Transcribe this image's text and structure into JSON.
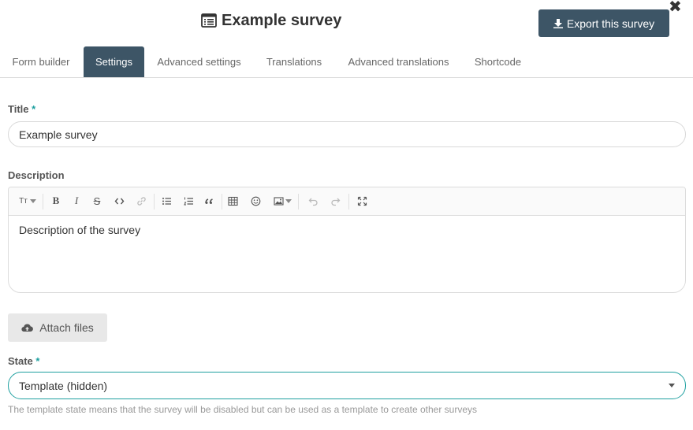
{
  "header": {
    "title": "Example survey",
    "title_icon": "list-alt-icon",
    "export_label": "Export this survey",
    "export_icon": "download-icon",
    "close_icon": "close-icon",
    "close_glyph": "✖"
  },
  "tabs": [
    {
      "label": "Form builder",
      "active": false
    },
    {
      "label": "Settings",
      "active": true
    },
    {
      "label": "Advanced settings",
      "active": false
    },
    {
      "label": "Translations",
      "active": false
    },
    {
      "label": "Advanced translations",
      "active": false
    },
    {
      "label": "Shortcode",
      "active": false
    }
  ],
  "form": {
    "title_label": "Title",
    "required_mark": "*",
    "title_value": "Example survey",
    "description_label": "Description",
    "description_value": "Description of the survey",
    "attach_label": "Attach files",
    "state_label": "State",
    "state_value": "Template (hidden)",
    "state_help": "The template state means that the survey will be disabled but can be used as a template to create other surveys"
  },
  "toolbar": {
    "heading": "Tт",
    "bold": "B",
    "italic": "I",
    "strike": "S"
  },
  "colors": {
    "primary": "#3d5566",
    "accent": "#1fa0a0"
  }
}
